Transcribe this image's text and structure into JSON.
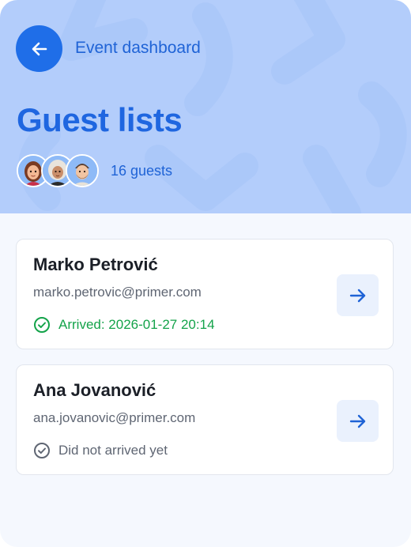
{
  "header": {
    "back_label": "Event dashboard",
    "title": "Guest lists",
    "guest_count_label": "16 guests",
    "avatars": [
      "woman-avatar",
      "woman-with-headscarf-avatar",
      "man-avatar"
    ]
  },
  "guests": [
    {
      "name": "Marko Petrović",
      "email": "marko.petrovic@primer.com",
      "status": "Arrived: 2026-01-27 20:14",
      "arrived": true
    },
    {
      "name": "Ana Jovanović",
      "email": "ana.jovanovic@primer.com",
      "status": "Did not arrived yet",
      "arrived": false
    }
  ],
  "colors": {
    "header_bg": "#b3cdfb",
    "accent": "#1f6ee8",
    "arrived": "#14a34a",
    "muted": "#5f6673"
  }
}
